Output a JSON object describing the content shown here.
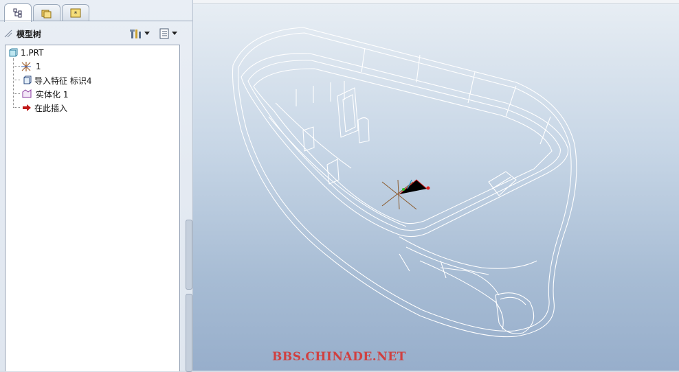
{
  "tabs": [
    {
      "icon": "model-tree-icon",
      "active": true
    },
    {
      "icon": "folder-browser-icon",
      "active": false
    },
    {
      "icon": "favorites-icon",
      "active": false
    }
  ],
  "tree": {
    "title": "模型树",
    "settings_icon": "tree-settings-icon",
    "show_icon": "tree-show-icon",
    "items": [
      {
        "label": "1.PRT",
        "icon": "part-icon"
      },
      {
        "label": "1",
        "icon": "csys-icon"
      },
      {
        "label": "导入特征 标识4",
        "icon": "import-feature-icon"
      },
      {
        "label": "实体化 1",
        "icon": "solidify-icon"
      },
      {
        "label": "在此插入",
        "icon": "insert-here-arrow-icon"
      }
    ]
  },
  "viewport": {
    "watermark": "BBS.CHINADE.NET",
    "colors": {
      "wireframe": "#ffffff",
      "watermark": "#d04040"
    }
  }
}
